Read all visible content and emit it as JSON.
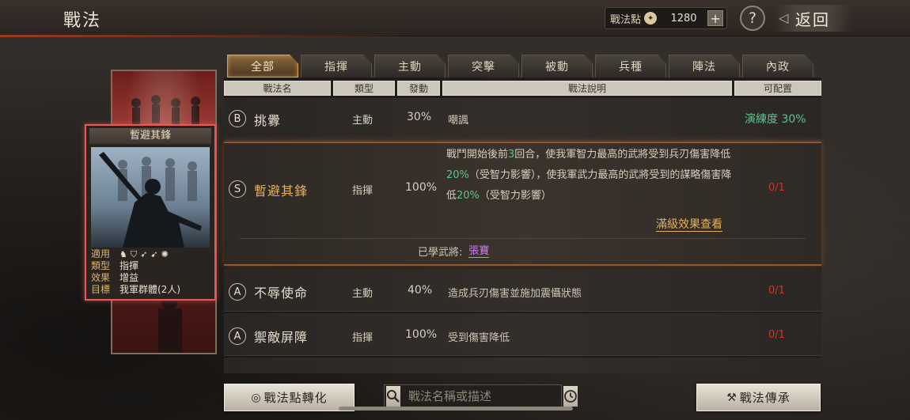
{
  "header": {
    "title": "戰法",
    "points_label": "戰法點",
    "points_value": "1280",
    "plus": "+",
    "help": "?",
    "back": "返回"
  },
  "tabs": [
    "全部",
    "指揮",
    "主動",
    "突擊",
    "被動",
    "兵種",
    "陣法",
    "內政"
  ],
  "columns": [
    "戰法名",
    "類型",
    "發動",
    "戰法說明",
    "可配置"
  ],
  "card": {
    "title": "暫避其鋒",
    "labels": {
      "units": "適用",
      "type": "類型",
      "effect": "效果",
      "target": "目標"
    },
    "type": "指揮",
    "effect": "增益",
    "target": "我軍群體(2人)",
    "unit_icons": [
      "cavalry-icon",
      "shield-icon",
      "bow-icon",
      "spear-icon",
      "wheel-icon"
    ]
  },
  "rows": [
    {
      "grade": "B",
      "name": "挑釁",
      "type": "主動",
      "rate": "30%",
      "desc": "嘲諷",
      "avail": "演練度 30%",
      "avail_kind": "prof"
    },
    {
      "grade": "S",
      "name": "暫避其鋒",
      "type": "指揮",
      "rate": "100%",
      "desc_parts": [
        "戰鬥開始後前",
        "3",
        "回合，使我軍智力最高的武將受到兵刃傷害降低",
        "20%",
        "（受智力影響），使我軍武力最高的武將受到的謀略傷害降低",
        "20%",
        "（受智力影響）"
      ],
      "avail": "0/1",
      "avail_kind": "count",
      "max_effect": "滿級效果查看",
      "learned_label": "已學武將:",
      "learned_name": "張寶"
    },
    {
      "grade": "A",
      "name": "不辱使命",
      "type": "主動",
      "rate": "40%",
      "desc": "造成兵刃傷害並施加震懾狀態",
      "avail": "0/1",
      "avail_kind": "count"
    },
    {
      "grade": "A",
      "name": "禦敵屏障",
      "type": "指揮",
      "rate": "100%",
      "desc": "受到傷害降低",
      "avail": "0/1",
      "avail_kind": "count"
    }
  ],
  "bottom": {
    "convert": "戰法點轉化",
    "search_placeholder": "戰法名稱或描述",
    "inherit": "戰法傳承"
  },
  "colors": {
    "accent_gold": "#e2b15f",
    "proficiency_green": "#5bc48c",
    "count_red": "#d9321f",
    "card_border": "#e85a59",
    "learned_purple": "#c680e8"
  }
}
